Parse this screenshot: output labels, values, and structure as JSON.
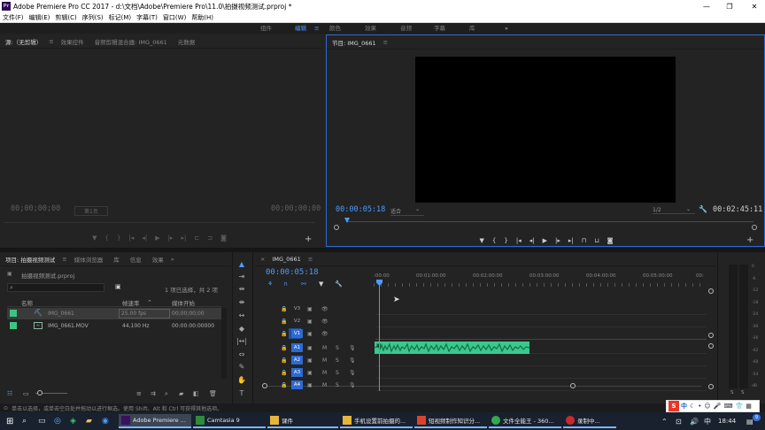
{
  "window": {
    "app_name": "Adobe Premiere Pro CC 2017",
    "title_path": "d:\\文档\\Adobe\\Premiere Pro\\11.0\\拍摄视频测试.prproj *",
    "app_icon": "Pr",
    "min_glyph": "—",
    "max_glyph": "❐",
    "close_glyph": "✕"
  },
  "menu": [
    "文件(F)",
    "编辑(E)",
    "剪辑(C)",
    "序列(S)",
    "标记(M)",
    "字幕(T)",
    "窗口(W)",
    "帮助(H)"
  ],
  "workspaces": {
    "items": [
      "组件",
      "编辑",
      "颜色",
      "效果",
      "音频",
      "字幕",
      "库"
    ],
    "active": "编辑",
    "more": "»"
  },
  "source_panel": {
    "tabs": [
      "源:（无剪辑）",
      "效果控件",
      "音频剪辑混合器: IMG_0661",
      "元数据"
    ],
    "tc_left": "00;00;00;00",
    "tc_right": "00;00;00;00",
    "page": "第1页"
  },
  "program_panel": {
    "tab": "节目: IMG_0661",
    "timecode": "00:00:05:18",
    "fit": "适合",
    "resolution": "1/2",
    "duration": "00:02:45:11"
  },
  "project_panel": {
    "tabs": [
      "项目: 拍摄视频测试",
      "媒体浏览器",
      "库",
      "信息",
      "效果"
    ],
    "file": "拍摄视频测试.prproj",
    "selection": "1 项已选择，共 2 项",
    "columns": [
      "名称",
      "帧速率",
      "媒体开始"
    ],
    "rows": [
      {
        "swatch": "#3dc47f",
        "name": "IMG_0661",
        "fps": "25.00 fps",
        "start": "00;00;00;00"
      },
      {
        "swatch": "#3dc47f",
        "name": "IMG_0661.MOV",
        "fps": "44,100 Hz",
        "start": "00:00:00:00000"
      }
    ]
  },
  "timeline": {
    "tab": "IMG_0661",
    "timecode": "00:00:05:18",
    "ruler": [
      ":00:00",
      "00:01:00:00",
      "00:02:00:00",
      "00:03:00:00",
      "00:04:00:00",
      "00:05:00:00",
      "00:"
    ],
    "video_tracks": [
      "V3",
      "V2",
      "V1"
    ],
    "audio_tracks": [
      "A1",
      "A2",
      "A3",
      "A4"
    ],
    "m": "M",
    "s": "S"
  },
  "meter": {
    "labels": [
      "S",
      "S"
    ],
    "scale": [
      "0",
      "-6",
      "-12",
      "-18",
      "-24",
      "-30",
      "-36",
      "-42",
      "-48",
      "-54",
      "dB"
    ]
  },
  "status": "单击以选择，或单击空白处并拖动以进行框选。使用 Shift、Alt 和 Ctrl 可获得其他选项。",
  "ime": {
    "logo": "S",
    "lang": "中"
  },
  "taskbar": {
    "items": [
      {
        "label": "Adobe Premiere ...",
        "color": "#3a1060",
        "active": true
      },
      {
        "label": "Camtasia 9",
        "color": "#2e8b3a"
      },
      {
        "label": "课件",
        "color": "#e7b43c"
      },
      {
        "label": "手机设置前拍摄的...",
        "color": "#e7b43c"
      },
      {
        "label": "短视频制作知识分...",
        "color": "#d9452c"
      },
      {
        "label": "文件全能王 - 360...",
        "color": "#36a852"
      },
      {
        "label": "录制中...",
        "color": "#cc2a2a"
      }
    ],
    "time": "18:44",
    "notify": "9"
  },
  "colors": {
    "accent": "#4b9bff",
    "audio_clip": "#38c98d",
    "panel": "#232323"
  }
}
